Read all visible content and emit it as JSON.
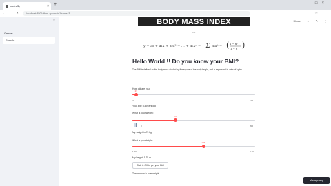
{
  "browser": {
    "tab_title": "main(3)",
    "url": "localhost:8501/#bmi-app/main?frame=3",
    "new_tab_icon": "plus-icon"
  },
  "sidebar": {
    "gender_label": "Gender",
    "gender_value": "Female"
  },
  "topbar": {
    "share_label": "Share",
    "icons": [
      "star-icon",
      "edit-icon",
      "menu-icon"
    ]
  },
  "main": {
    "banner": "BODY MASS INDEX",
    "banner_sub": "BMI",
    "heading": "Hello World !! Do you know your BMI?",
    "paragraph": "The BMI is defined as the body mass divided by the square of the body height, and is expressed in units of kg/m²",
    "age_label": "How old are you:",
    "age_value": "23",
    "age_min": "21",
    "age_max": "100",
    "age_progress": 0.03,
    "age_result": "Your age: 23 years old",
    "weight_label": "What is your weight:",
    "weight_value": "70",
    "weight_min": "0",
    "weight_max": "200",
    "weight_progress": 0.35,
    "weight_result": "My weight is 70 kg",
    "height_label": "What is your height:",
    "height_value": "1.75",
    "height_min": "1.00",
    "height_max": "2.10",
    "height_progress": 0.58,
    "height_result": "My height: 1.75 m",
    "button_label": "Click & OK to get your BMI",
    "bottom_text": "The woman is overweight"
  },
  "footer": {
    "manage_label": "Manage app"
  },
  "colors": {
    "accent": "#ff4b4b",
    "sidebar_bg": "#f0f2f6",
    "banner_bg": "#222222"
  }
}
